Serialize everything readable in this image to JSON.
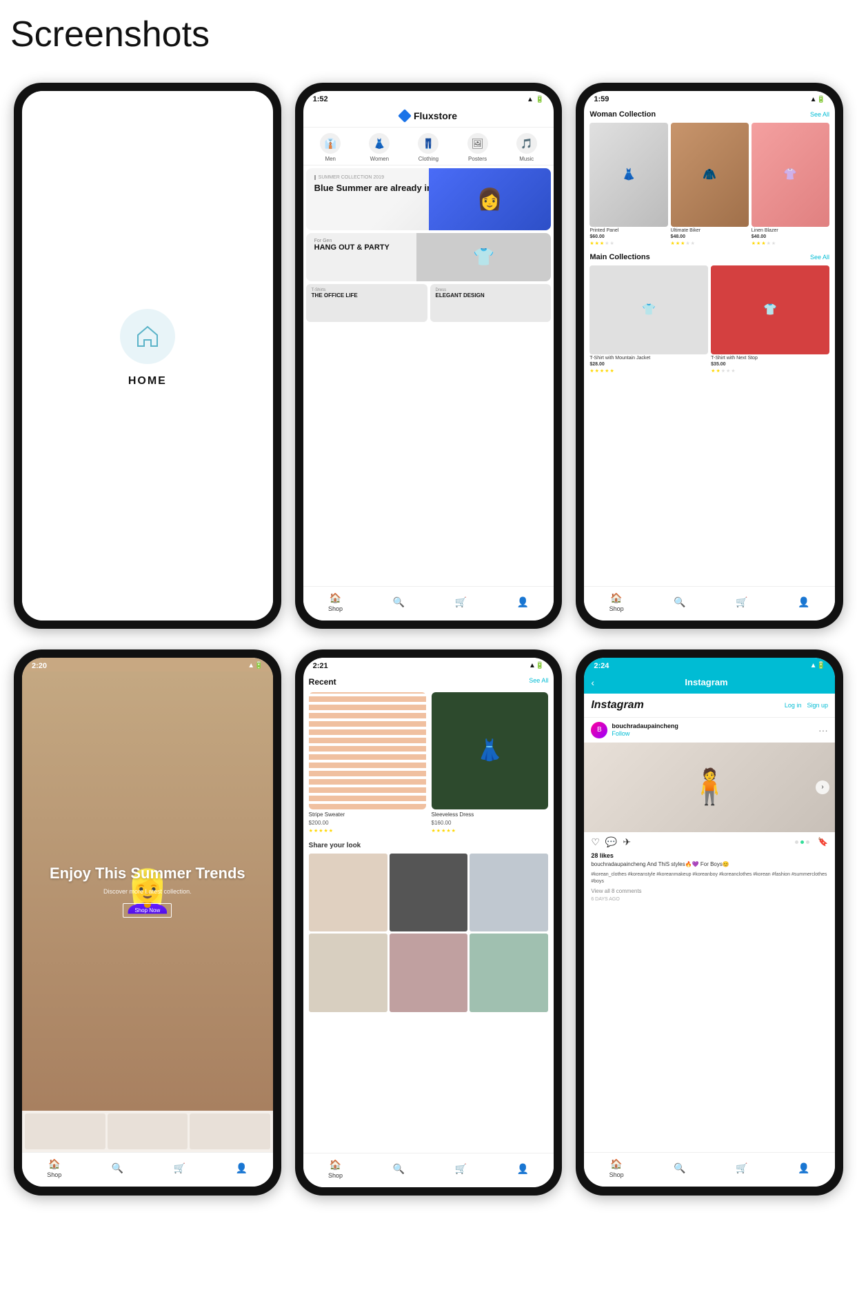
{
  "page": {
    "title": "Screenshots"
  },
  "phones": {
    "home": {
      "label": "HOME",
      "icon": "🏠"
    },
    "fluxstore": {
      "time": "1:52",
      "app_name": "Fluxstore",
      "categories": [
        {
          "name": "Men",
          "icon": "👔"
        },
        {
          "name": "Women",
          "icon": "👗"
        },
        {
          "name": "Clothing",
          "icon": "👖"
        },
        {
          "name": "Posters",
          "icon": "🖼"
        },
        {
          "name": "Music",
          "icon": "🎵"
        }
      ],
      "banner1": {
        "tag": "SUMMER COLLECTION 2019",
        "title": "Blue Summer are already in store"
      },
      "banner2": {
        "sub": "For Gen",
        "title": "HANG OUT & PARTY"
      },
      "mini1": {
        "sub": "T-Shirts",
        "title": "THE OFFICE LIFE"
      },
      "mini2": {
        "sub": "Dress",
        "title": "ELEGANT DESIGN"
      },
      "nav": [
        "Shop",
        "Search",
        "Cart",
        "Profile"
      ]
    },
    "woman_collection": {
      "time": "1:59",
      "section1_title": "Woman Collection",
      "see_all": "See All",
      "products1": [
        {
          "name": "Printed Panel",
          "price": "$60.00",
          "stars": 3
        },
        {
          "name": "Ultimate Biker",
          "price": "$48.00",
          "stars": 3
        },
        {
          "name": "Linen Blazer",
          "price": "$40.00",
          "stars": 3
        }
      ],
      "section2_title": "Main Collections",
      "products2": [
        {
          "name": "T-Shirt with Mountain Jacket",
          "price": "$28.00",
          "stars": 5
        },
        {
          "name": "T-Shirt with Next Stop",
          "price": "$35.00",
          "stars": 2
        }
      ],
      "nav": [
        "Shop",
        "Search",
        "Cart",
        "Profile"
      ]
    },
    "summer": {
      "time": "2:20",
      "title": "Enjoy This Summer Trends",
      "subtitle": "Discover more Latest collection.",
      "btn": "Shop Now",
      "nav": [
        "Shop",
        "Search",
        "Cart",
        "Profile"
      ]
    },
    "recent": {
      "time": "2:21",
      "section_title": "Recent",
      "see_all": "See All",
      "products": [
        {
          "name": "Stripe Sweater",
          "price": "$200.00",
          "stars": 5
        },
        {
          "name": "Sleeveless Dress",
          "price": "$160.00",
          "stars": 5
        }
      ],
      "share_title": "Share your look",
      "nav": [
        "Shop",
        "Search",
        "Cart",
        "Profile"
      ]
    },
    "instagram": {
      "time": "2:24",
      "header_title": "Instagram",
      "app_title": "Instagram",
      "login": "Log in",
      "signup": "Sign up",
      "username": "bouchradaupaincheng",
      "follow": "Follow",
      "likes": "28 likes",
      "caption": "bouchradaupaincheng And ThiS styles🔥💜 For Boys😊",
      "hashtags": "#korean_clothes #koreanstyle #koreanmakeup #koreanboy #koreanclothes #korean #fashion #summerclothes #boys",
      "view_comments": "View all 8 comments",
      "time_ago": "6 DAYS AGO",
      "nav": [
        "Shop",
        "Search",
        "Cart",
        "Profile"
      ]
    }
  }
}
